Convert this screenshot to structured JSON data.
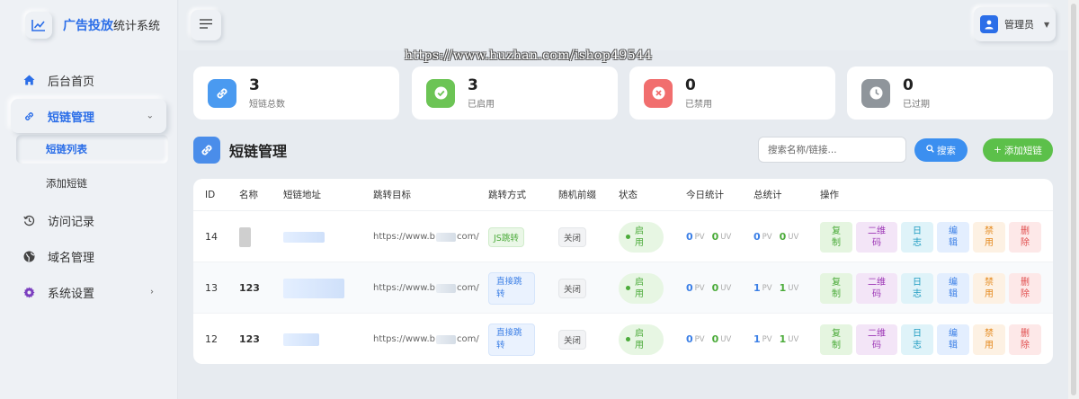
{
  "brand": {
    "title_strong": "广告投放",
    "title_rest": "统计系统"
  },
  "sidebar": {
    "items": [
      {
        "label": "后台首页"
      },
      {
        "label": "短链管理"
      },
      {
        "label": "访问记录"
      },
      {
        "label": "域名管理"
      },
      {
        "label": "系统设置"
      }
    ],
    "sub_items": [
      {
        "label": "短链列表"
      },
      {
        "label": "添加短链"
      }
    ]
  },
  "topbar": {
    "user": "管理员"
  },
  "watermark": "https://www.huzhan.com/ishop49544",
  "stats": [
    {
      "value": "3",
      "label": "短链总数",
      "color": "#4a9af0"
    },
    {
      "value": "3",
      "label": "已启用",
      "color": "#6cc455"
    },
    {
      "value": "0",
      "label": "已禁用",
      "color": "#f16e6e"
    },
    {
      "value": "0",
      "label": "已过期",
      "color": "#8f959b"
    }
  ],
  "page": {
    "title": "短链管理"
  },
  "search": {
    "placeholder": "搜索名称/链接...",
    "button": "搜索"
  },
  "add_button": "添加短链",
  "table": {
    "headers": [
      "ID",
      "名称",
      "短链地址",
      "跳转目标",
      "跳转方式",
      "随机前缀",
      "状态",
      "今日统计",
      "总统计",
      "操作"
    ],
    "rows": [
      {
        "id": "14",
        "name": "",
        "target_pre": "https://www.b",
        "target_post": "com/",
        "mode": "JS跳转",
        "prefix": "关闭",
        "status": "启用",
        "today_pv": "0",
        "today_uv": "0",
        "total_pv": "0",
        "total_uv": "0"
      },
      {
        "id": "13",
        "name": "123",
        "target_pre": "https://www.b",
        "target_post": "com/",
        "mode": "直接跳转",
        "prefix": "关闭",
        "status": "启用",
        "today_pv": "0",
        "today_uv": "0",
        "total_pv": "1",
        "total_uv": "1"
      },
      {
        "id": "12",
        "name": "123",
        "target_pre": "https://www.b",
        "target_post": "com/",
        "mode": "直接跳转",
        "prefix": "关闭",
        "status": "启用",
        "today_pv": "0",
        "today_uv": "0",
        "total_pv": "1",
        "total_uv": "1"
      }
    ],
    "units": {
      "pv": "PV",
      "uv": "UV"
    },
    "ops": [
      "复制",
      "二维码",
      "日志",
      "编辑",
      "禁用",
      "删除"
    ]
  }
}
